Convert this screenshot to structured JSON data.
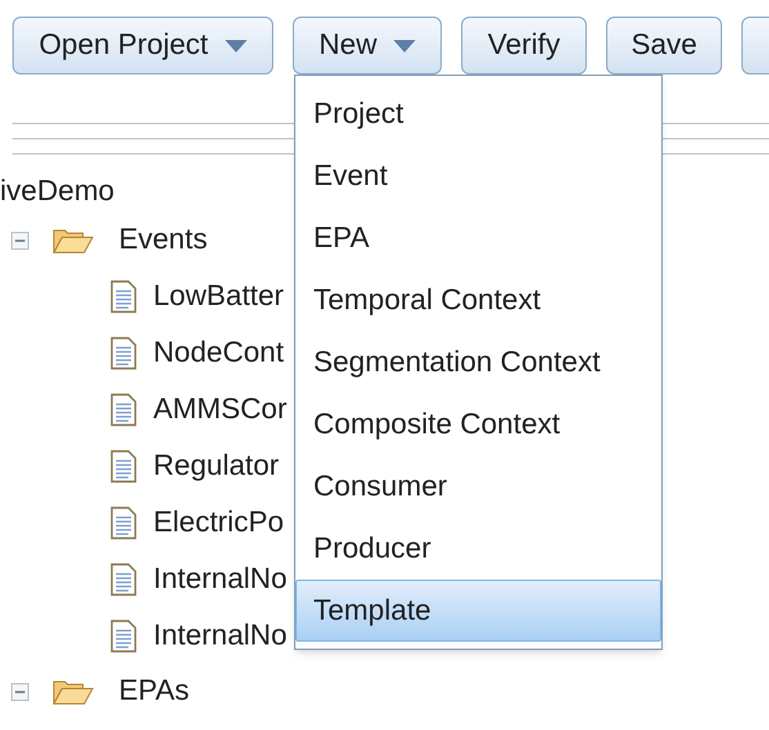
{
  "toolbar": [
    {
      "label": "Open Project",
      "dropdown": true
    },
    {
      "label": "New",
      "dropdown": true
    },
    {
      "label": "Verify",
      "dropdown": false
    },
    {
      "label": "Save",
      "dropdown": false
    }
  ],
  "tree": {
    "label": "iveDemo",
    "children": [
      {
        "label": "Events",
        "expanded": true,
        "children": [
          {
            "label": "LowBatter"
          },
          {
            "label": "NodeCont"
          },
          {
            "label": "AMMSCor"
          },
          {
            "label": "Regulator"
          },
          {
            "label": "ElectricPo"
          },
          {
            "label": "InternalNo"
          },
          {
            "label": "InternalNo"
          }
        ]
      },
      {
        "label": "EPAs",
        "expanded": true
      }
    ]
  },
  "menu": [
    {
      "label": "Project",
      "selected": false
    },
    {
      "label": "Event",
      "selected": false
    },
    {
      "label": "EPA",
      "selected": false
    },
    {
      "label": "Temporal Context",
      "selected": false
    },
    {
      "label": "Segmentation Context",
      "selected": false
    },
    {
      "label": "Composite Context",
      "selected": false
    },
    {
      "label": "Consumer",
      "selected": false
    },
    {
      "label": "Producer",
      "selected": false
    },
    {
      "label": "Template",
      "selected": true
    }
  ]
}
